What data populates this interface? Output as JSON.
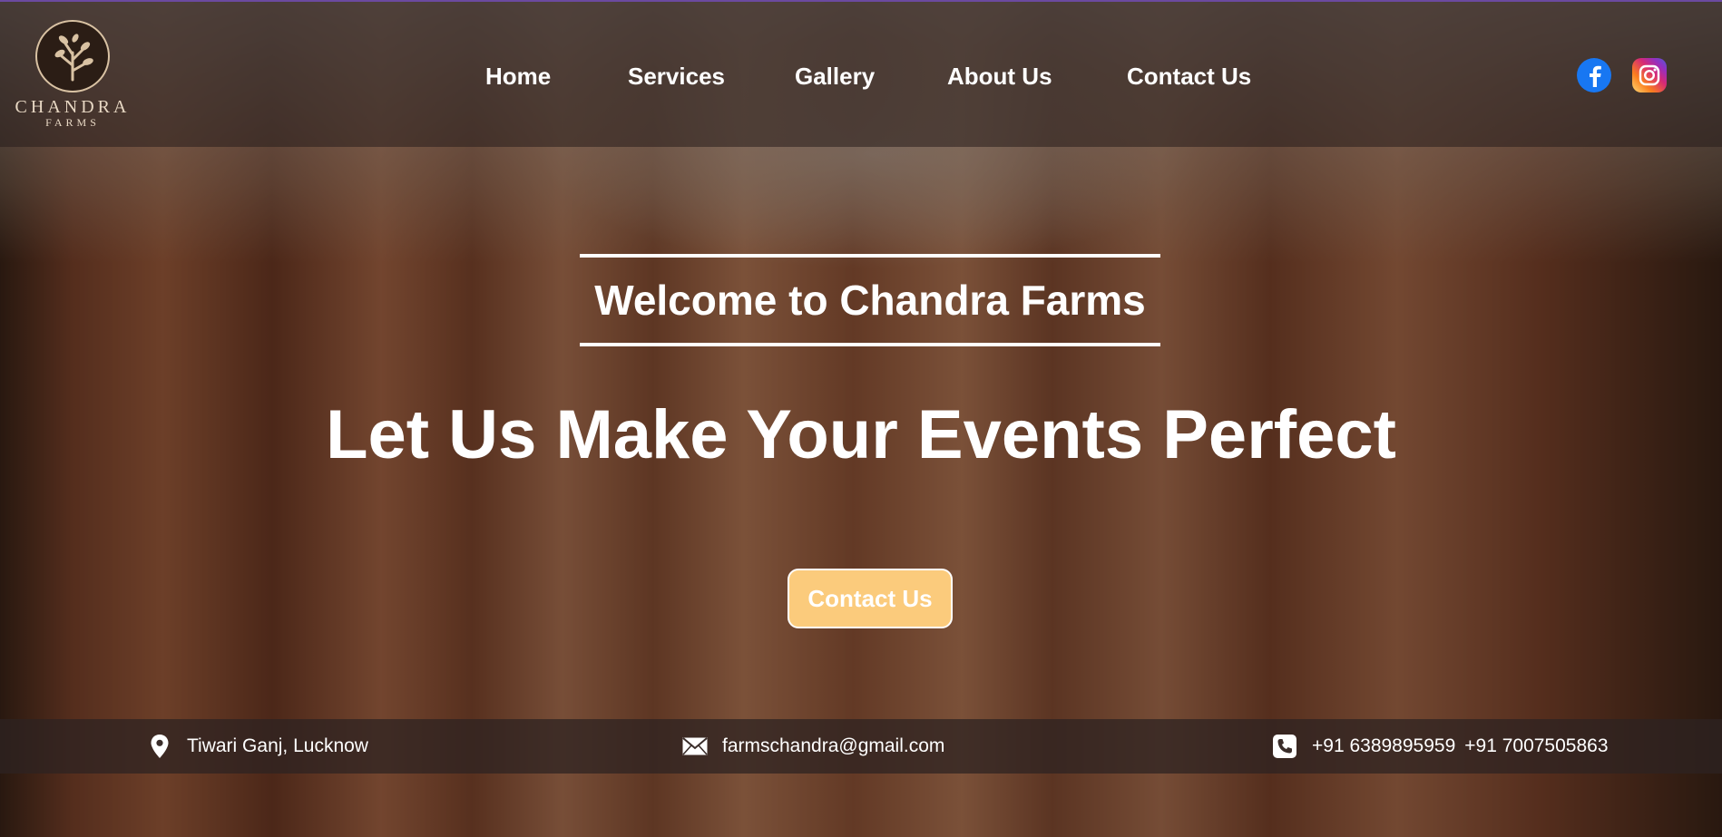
{
  "brand": {
    "name": "CHANDRA",
    "sub": "FARMS"
  },
  "nav": {
    "items": [
      "Home",
      "Services",
      "Gallery",
      "About Us",
      "Contact Us"
    ]
  },
  "social": {
    "facebook_icon": "facebook-icon",
    "instagram_icon": "instagram-icon"
  },
  "hero": {
    "welcome": "Welcome to Chandra Farms",
    "headline": "Let Us Make Your Events Perfect",
    "cta_label": "Contact Us",
    "cta_color": "#fbcb7c"
  },
  "info": {
    "address": "Tiwari Ganj, Lucknow",
    "email": "farmschandra@gmail.com",
    "phone1": "+91 6389895959",
    "phone2": "+91 7007505863"
  }
}
